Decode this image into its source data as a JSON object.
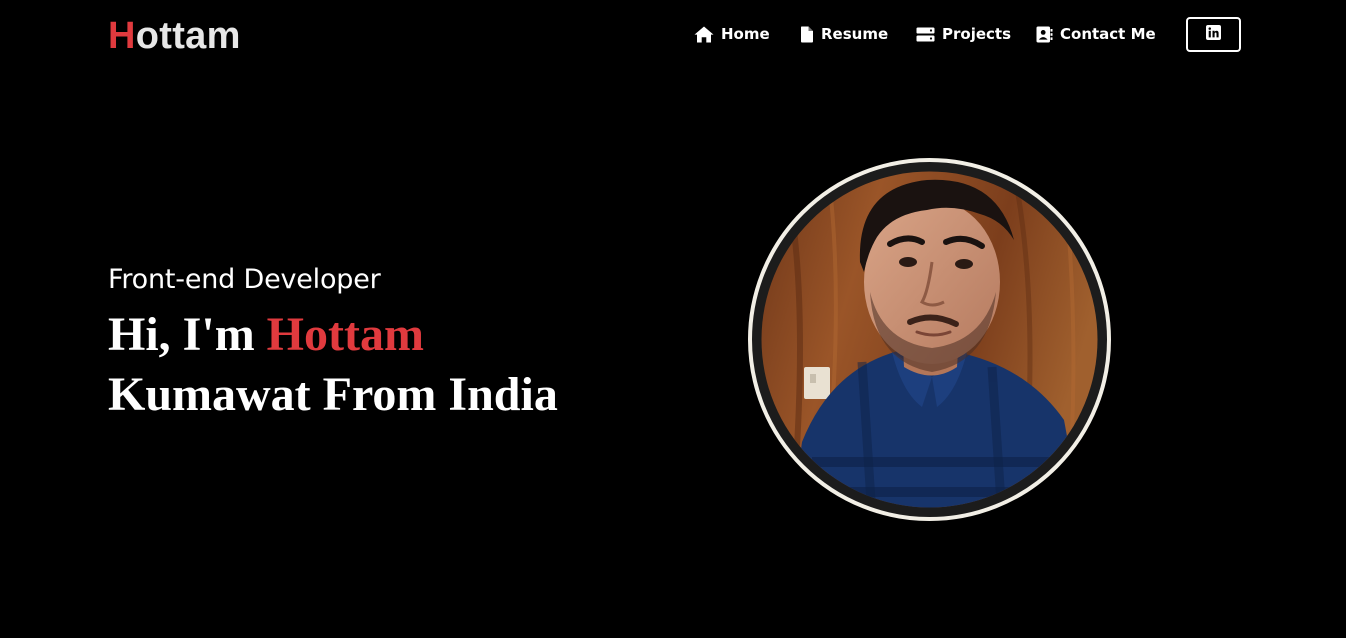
{
  "brand": {
    "initial": "H",
    "rest": "ottam"
  },
  "nav": {
    "items": [
      {
        "label": "Home",
        "icon": "home-icon"
      },
      {
        "label": "Resume",
        "icon": "document-icon"
      },
      {
        "label": "Projects",
        "icon": "server-icon"
      },
      {
        "label": "Contact Me",
        "icon": "address-book-icon"
      }
    ],
    "social": {
      "icon": "linkedin-icon"
    }
  },
  "hero": {
    "role": "Front-end Developer",
    "greeting": "Hi, I'm ",
    "name": "Hottam",
    "line2": "Kumawat From India"
  },
  "colors": {
    "background": "#000000",
    "accent": "#e03a3e",
    "text": "#ffffff",
    "avatar_ring": "#f2efe6"
  }
}
